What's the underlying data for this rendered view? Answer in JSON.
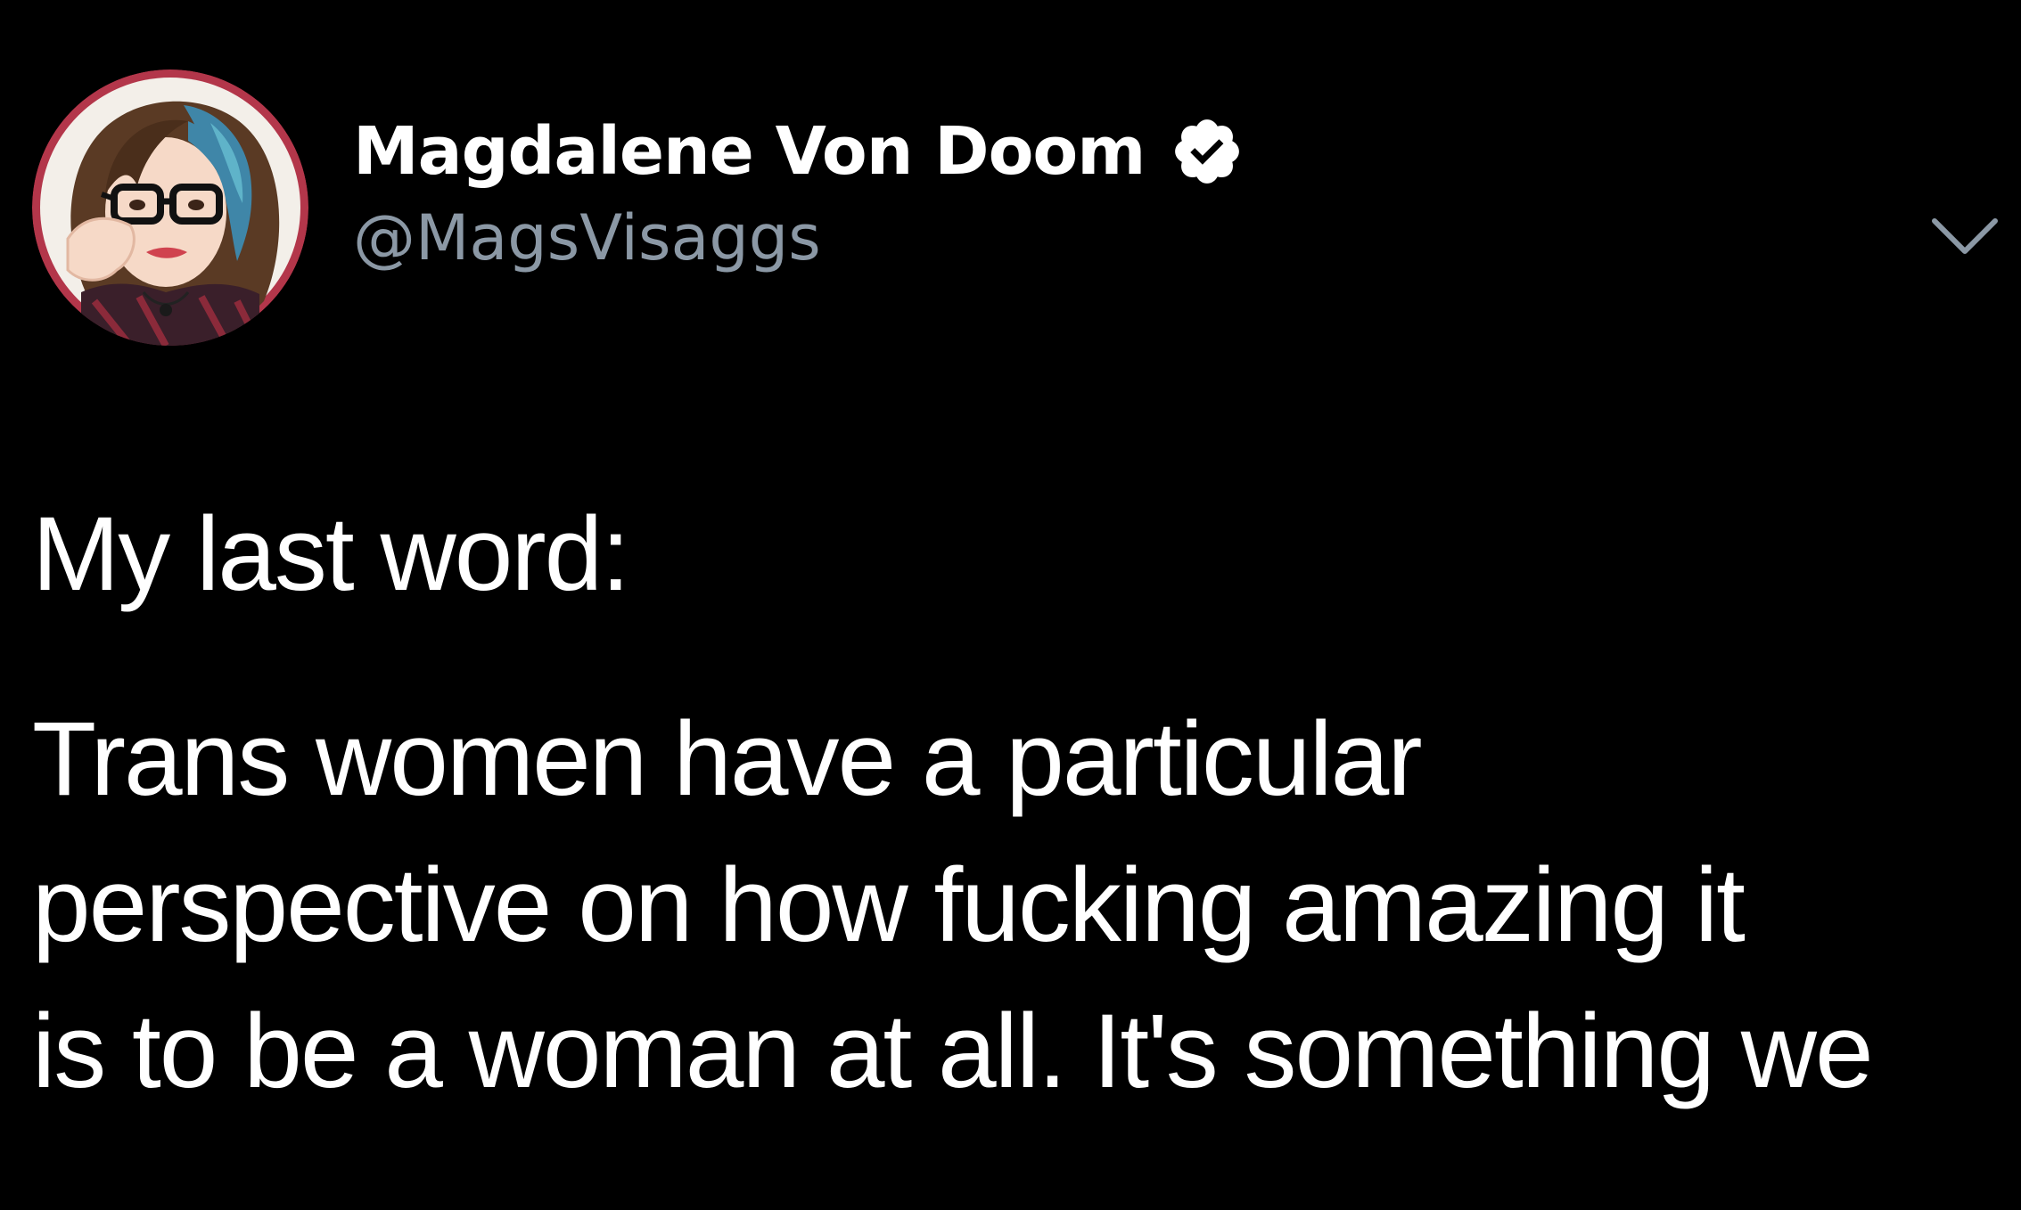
{
  "tweet": {
    "display_name": "Magdalene Von Doom",
    "handle": "@MagsVisaggs",
    "verified": true,
    "text": {
      "line1": "My last word:",
      "paragraph2": "Trans women have a particular\nperspective on how fucking amazing it\nis to be a woman at all. It's something we"
    }
  },
  "icons": {
    "verified": "verified-badge-icon",
    "menu": "chevron-down-icon"
  },
  "colors": {
    "background": "#000000",
    "text": "#ffffff",
    "handle": "#8b98a5",
    "chevron": "#8b98a5"
  }
}
